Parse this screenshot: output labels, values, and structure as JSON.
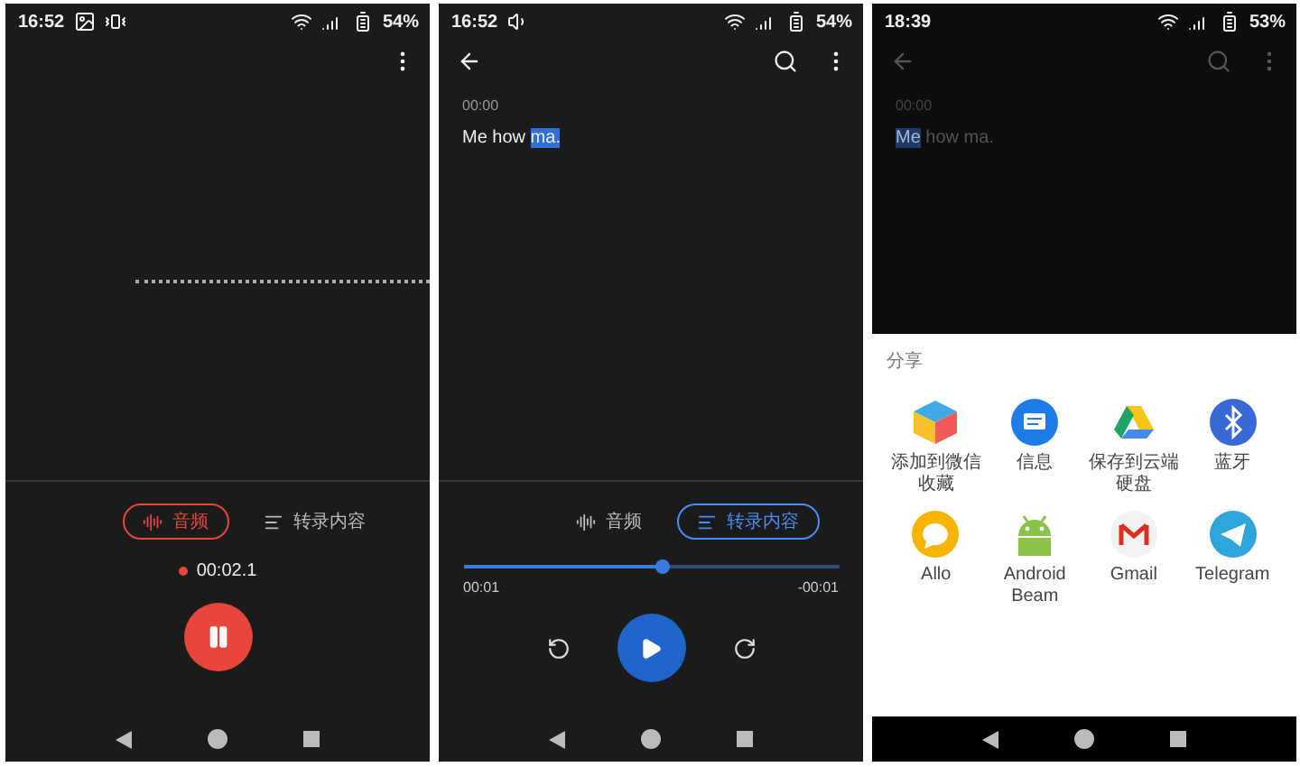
{
  "screens": [
    {
      "kind": "recording",
      "status": {
        "time": "16:52",
        "battery": "54%"
      },
      "tabs": [
        {
          "label": "音频",
          "selected": true
        },
        {
          "label": "转录内容",
          "selected": false
        }
      ],
      "timer": "00:02.1"
    },
    {
      "kind": "transcript",
      "status": {
        "time": "16:52",
        "battery": "54%"
      },
      "timestamp": "00:00",
      "transcript": [
        {
          "text": "Me how ",
          "selected": false
        },
        {
          "text": "ma.",
          "selected": true
        }
      ],
      "tabs": [
        {
          "label": "音频",
          "selected": false
        },
        {
          "label": "转录内容",
          "selected": true
        }
      ],
      "player": {
        "level": 0.53,
        "elapsed": "00:01",
        "remaining": "-00:01"
      }
    },
    {
      "kind": "share",
      "status": {
        "time": "18:39",
        "battery": "53%"
      },
      "timestamp": "00:00",
      "transcript": [
        {
          "text": "Me",
          "selected": true
        },
        {
          "text": " how ma.",
          "selected": false
        }
      ],
      "share": {
        "title": "分享",
        "apps": [
          {
            "label": "添加到微信收藏"
          },
          {
            "label": "信息"
          },
          {
            "label": "保存到云端硬盘"
          },
          {
            "label": "蓝牙"
          },
          {
            "label": "Allo"
          },
          {
            "label": "Android Beam"
          },
          {
            "label": "Gmail"
          },
          {
            "label": "Telegram"
          }
        ]
      }
    }
  ]
}
